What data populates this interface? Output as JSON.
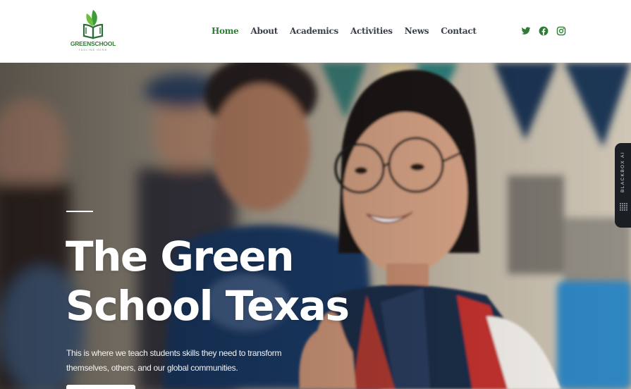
{
  "brand": {
    "name": "GREENSCHOOL",
    "tagline": "TAGLINE HERE"
  },
  "nav": {
    "items": [
      {
        "label": "Home",
        "active": true
      },
      {
        "label": "About",
        "active": false
      },
      {
        "label": "Academics",
        "active": false
      },
      {
        "label": "Activities",
        "active": false
      },
      {
        "label": "News",
        "active": false
      },
      {
        "label": "Contact",
        "active": false
      }
    ]
  },
  "social": {
    "icons": [
      "twitter-icon",
      "facebook-icon",
      "instagram-icon"
    ],
    "color": "#2e7d32"
  },
  "hero": {
    "title_line1": "The Green",
    "title_line2": "School Texas",
    "subtitle": "This is where we teach students skills they need to transform themselves, others, and our global communities.",
    "button_label": ""
  },
  "side_tab": {
    "label": "BLACKBOX AI"
  },
  "colors": {
    "accent": "#2e7d32",
    "nav_text": "#3a3f4a",
    "hero_text": "#ffffff"
  }
}
